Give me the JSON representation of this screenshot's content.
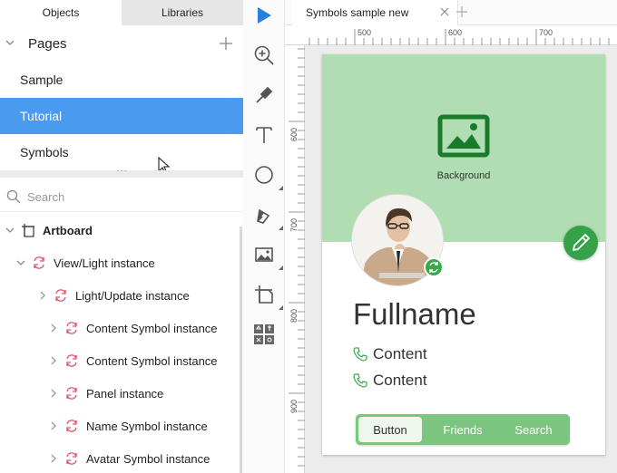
{
  "left_panel": {
    "tabs": [
      {
        "label": "Objects"
      },
      {
        "label": "Libraries"
      }
    ],
    "pages_header": "Pages",
    "pages": [
      {
        "label": "Sample"
      },
      {
        "label": "Tutorial"
      },
      {
        "label": "Symbols"
      }
    ],
    "selected_page": "Tutorial",
    "search_placeholder": "Search",
    "layers": [
      {
        "label": "Artboard"
      },
      {
        "label": "View/Light instance"
      },
      {
        "label": "Light/Update instance"
      },
      {
        "label": "Content Symbol instance"
      },
      {
        "label": "Content Symbol instance"
      },
      {
        "label": "Panel instance"
      },
      {
        "label": "Name Symbol instance"
      },
      {
        "label": "Avatar Symbol instance"
      }
    ]
  },
  "document": {
    "tab_title": "Symbols sample new"
  },
  "rulers": {
    "top": [
      "500",
      "600",
      "700"
    ],
    "left": [
      "600",
      "700",
      "800",
      "900"
    ]
  },
  "artboard": {
    "background_label": "Background",
    "fullname": "Fullname",
    "contents": [
      "Content",
      "Content"
    ],
    "segments": [
      {
        "label": "Button"
      },
      {
        "label": "Friends"
      },
      {
        "label": "Search"
      }
    ]
  },
  "colors": {
    "selection_blue": "#4a9bf0",
    "header_green": "#b0ddb1",
    "accent_green": "#35a24a",
    "segment_green": "#7cc57e",
    "tool_blue": "#2a7de1",
    "symbol_pink": "#e2506a"
  }
}
